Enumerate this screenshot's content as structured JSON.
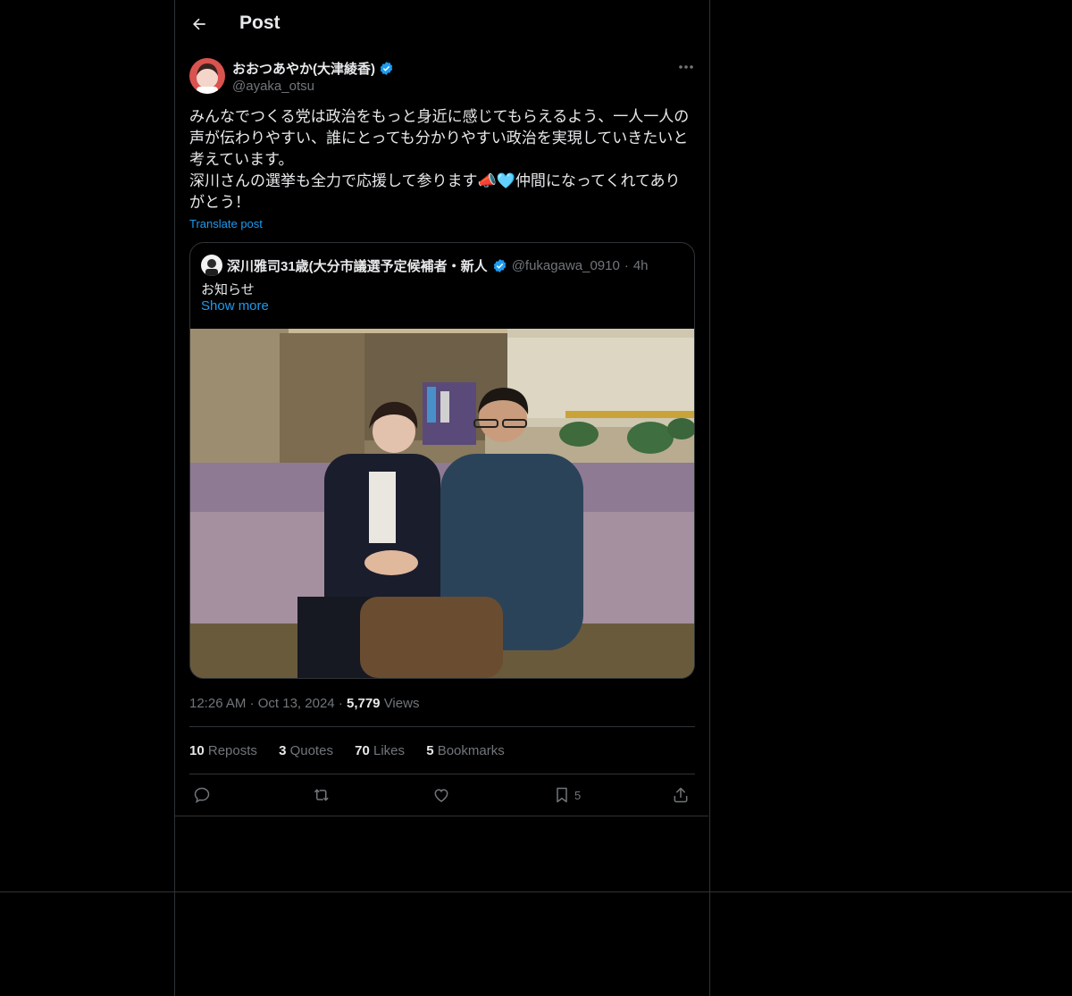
{
  "header": {
    "title": "Post"
  },
  "post": {
    "author": {
      "name": "おおつあやか(大津綾香)",
      "handle": "@ayaka_otsu"
    },
    "text_lines": [
      "みんなでつくる党は政治をもっと身近に感じてもらえるよう、一人一人の声が伝わりやすい、誰にとっても分かりやすい政治を実現していきたいと考えています。",
      "深川さんの選挙も全力で応援して参ります📣🩵仲間になってくれてありがとう！"
    ],
    "translate_label": "Translate post",
    "quote": {
      "name": "深川雅司31歳(大分市議選予定候補者・新人",
      "handle": "@fukagawa_0910",
      "dot": "·",
      "time": "4h",
      "text": "お知らせ",
      "show_more": "Show more"
    },
    "meta": {
      "time": "12:26 AM",
      "dot": "·",
      "date": "Oct 13, 2024",
      "views_count": "5,779",
      "views_label": "Views"
    },
    "stats": [
      {
        "count": "10",
        "label": "Reposts"
      },
      {
        "count": "3",
        "label": "Quotes"
      },
      {
        "count": "70",
        "label": "Likes"
      },
      {
        "count": "5",
        "label": "Bookmarks"
      }
    ],
    "actions": {
      "bookmark_count": "5"
    }
  },
  "colors": {
    "background": "#000000",
    "border": "#2f3336",
    "text_primary": "#e7e9ea",
    "text_secondary": "#71767b",
    "accent": "#1d9bf0"
  }
}
